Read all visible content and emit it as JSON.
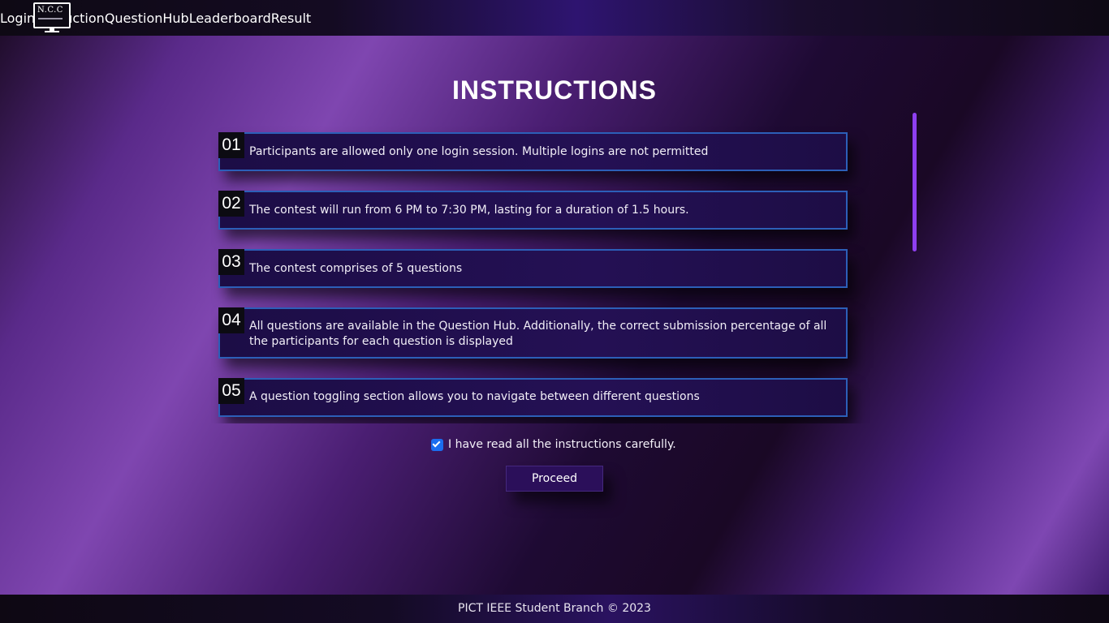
{
  "header": {
    "logo_text": "N.C.C",
    "nav": [
      {
        "label": "Login"
      },
      {
        "label": "Instruction"
      },
      {
        "label": "QuestionHub"
      },
      {
        "label": "Leaderboard"
      },
      {
        "label": "Result"
      }
    ]
  },
  "main": {
    "title": "INSTRUCTIONS",
    "instructions": [
      {
        "number": "01",
        "text": "Participants are allowed only one login session. Multiple logins are not permitted"
      },
      {
        "number": "02",
        "text": "The contest will run from 6 PM to 7:30 PM, lasting for a duration of 1.5 hours."
      },
      {
        "number": "03",
        "text": "The contest comprises of 5 questions"
      },
      {
        "number": "04",
        "text": "All questions are available in the Question Hub. Additionally, the correct submission percentage of all the participants for each question is displayed"
      },
      {
        "number": "05",
        "text": "A question toggling section allows you to navigate between different questions"
      }
    ],
    "agree": {
      "label": "I have read all the instructions carefully.",
      "checked": true
    },
    "proceed_label": "Proceed"
  },
  "footer": {
    "text": "PICT IEEE Student Branch © 2023"
  },
  "colors": {
    "accent_scrollbar": "#8e3ff0",
    "checkbox": "#1b6df0",
    "card_border": "#2c5fb8",
    "button_bg": "#2b0f5a"
  }
}
